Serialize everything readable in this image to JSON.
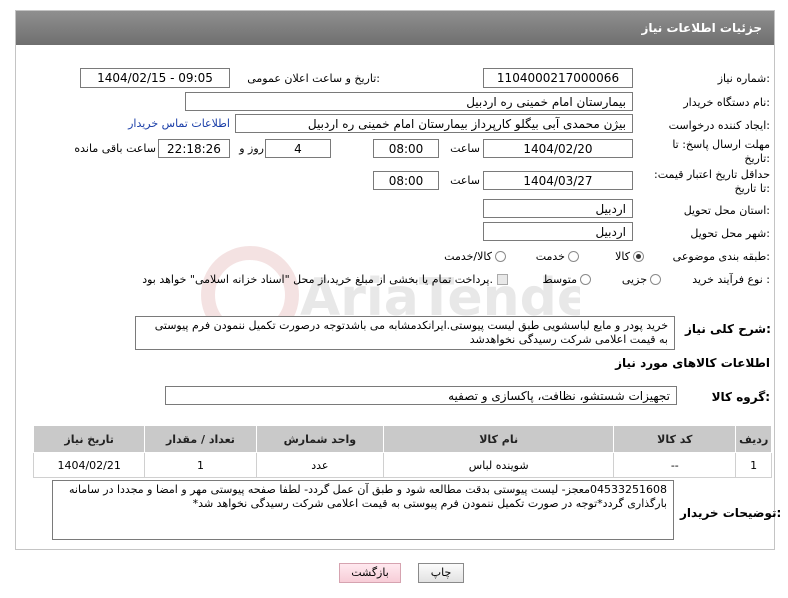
{
  "header": {
    "title": "جزئیات اطلاعات نیاز"
  },
  "fields": {
    "need_number": {
      "label": "شماره نیاز:",
      "value": "1104000217000066"
    },
    "announce_datetime": {
      "label": "تاریخ و ساعت اعلان عمومی:",
      "value": "1404/02/15 - 09:05"
    },
    "buyer_org": {
      "label": "نام دستگاه خریدار:",
      "value": "بیمارستان امام خمینی  ره  اردبیل"
    },
    "requester": {
      "label": "ایجاد کننده درخواست:",
      "value": "بیژن محمدی آبی بیگلو کارپرداز بیمارستان امام خمینی  ره  اردبیل",
      "contact_link": "اطلاعات تماس خریدار"
    },
    "reply_deadline": {
      "label": "مهلت ارسال پاسخ: تا تاریخ:",
      "date": "1404/02/20",
      "time_label": "ساعت",
      "time": "08:00",
      "days": "4",
      "days_label": "روز و",
      "remaining": "22:18:26",
      "remaining_label": "ساعت باقی مانده"
    },
    "price_validity": {
      "label": "حداقل تاریخ اعتبار قیمت: تا تاریخ:",
      "date": "1404/03/27",
      "time_label": "ساعت",
      "time": "08:00"
    },
    "delivery_province": {
      "label": "استان محل تحویل:",
      "value": "اردبیل"
    },
    "delivery_city": {
      "label": "شهر محل تحویل:",
      "value": "اردبیل"
    },
    "category": {
      "label": "طبقه بندی موضوعی:",
      "options": [
        "کالا",
        "خدمت",
        "کالا/خدمت"
      ],
      "selected": "کالا"
    },
    "purchase_process": {
      "label": "نوع فرآیند خرید :",
      "options": [
        "جزیی",
        "متوسط"
      ],
      "selected": "جزیی",
      "payment_note": "پرداخت تمام یا بخشی از مبلغ خرید،از محل \"اسناد خزانه اسلامی\" خواهد بود."
    }
  },
  "description": {
    "label": "شرح کلی نیاز:",
    "text": "خرید پودر و مایع لباسشویی طبق لیست پیوستی.ایرانکدمشابه می باشدتوجه درصورت تکمیل ننمودن فرم پیوستی به قیمت اعلامی شرکت رسیدگی نخواهدشد"
  },
  "goods_section": {
    "title": "اطلاعات کالاهای مورد نیاز",
    "group_label": "گروه کالا:",
    "group_value": "تجهیزات شستشو، نظافت، پاکسازی و تصفیه"
  },
  "table": {
    "columns": [
      "ردیف",
      "کد کالا",
      "نام کالا",
      "واحد شمارش",
      "تعداد / مقدار",
      "تاریخ نیاز"
    ],
    "rows": [
      [
        "1",
        "--",
        "شوینده لباس",
        "عدد",
        "1",
        "1404/02/21"
      ]
    ]
  },
  "buyer_notes": {
    "label": "توضیحات خریدار:",
    "text": "04533251608معجز- لیست پیوستی بدقت مطالعه شود و طبق آن عمل گردد- لطفا صفحه پیوستی مهر و امضا و مجددا در سامانه بارگذاری گردد*توجه در صورت تکمیل ننمودن فرم پیوستی به قیمت اعلامی شرکت رسیدگی نخواهد شد*"
  },
  "buttons": {
    "print": "چاپ",
    "back": "بازگشت"
  },
  "watermark": {
    "text": "AriaTender.net"
  },
  "colors": {
    "header_bg": "#7f7f7f",
    "table_header_bg": "#c9c9c9",
    "link": "#1a3ea8",
    "back_button": "#f7cdd7"
  }
}
